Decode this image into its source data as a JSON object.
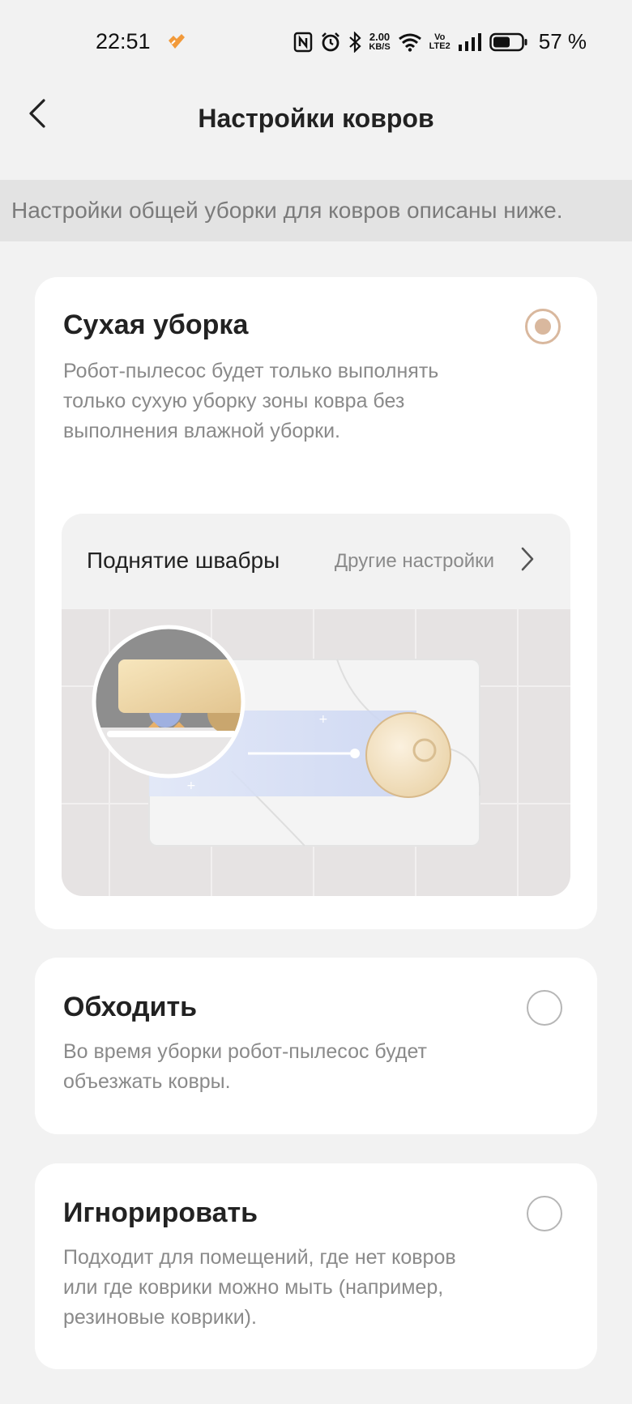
{
  "status_bar": {
    "time": "22:51",
    "net_speed_value": "2.00",
    "net_speed_unit": "KB/S",
    "volte_line1": "Vo",
    "volte_line2": "LTE2",
    "battery_percent": "57 %"
  },
  "header": {
    "title": "Настройки ковров"
  },
  "banner": {
    "text": "Настройки общей уборки для ковров описаны ниже."
  },
  "options": {
    "dry": {
      "title": "Сухая уборка",
      "description": "Робот-пылесос будет только выполнять только сухую уборку зоны ковра без выполнения влажной уборки.",
      "selected": true,
      "mop_lift": {
        "label": "Поднятие швабры",
        "more_label": "Другие настройки"
      }
    },
    "avoid": {
      "title": "Обходить",
      "description": "Во время уборки робот-пылесос будет объезжать ковры.",
      "selected": false
    },
    "ignore": {
      "title": "Игнорировать",
      "description": "Подходит для помещений, где нет ковров или где коврики можно мыть (например, резиновые коврики).",
      "selected": false
    }
  },
  "colors": {
    "accent": "#d9b89e",
    "background": "#f2f2f2",
    "card": "#ffffff",
    "banner": "#e3e3e3"
  }
}
